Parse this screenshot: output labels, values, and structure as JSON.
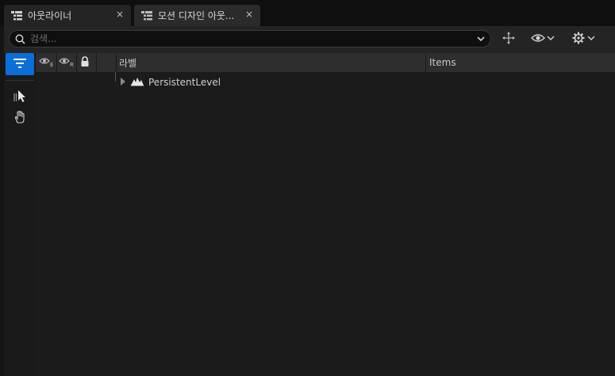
{
  "tabs": [
    {
      "label": "아웃라이너",
      "icon": "outliner-list-icon",
      "close": "×"
    },
    {
      "label": "모션 디자인 아웃...",
      "icon": "outliner-list-icon",
      "close": "×"
    }
  ],
  "search": {
    "placeholder": "검색..."
  },
  "columns": {
    "label": "라벨",
    "items": "Items"
  },
  "tree": [
    {
      "label": "PersistentLevel",
      "icon": "level-icon",
      "expanded": false
    }
  ],
  "colors": {
    "accent": "#0a6fd6",
    "panel": "#242424",
    "body": "#1b1b1b"
  }
}
